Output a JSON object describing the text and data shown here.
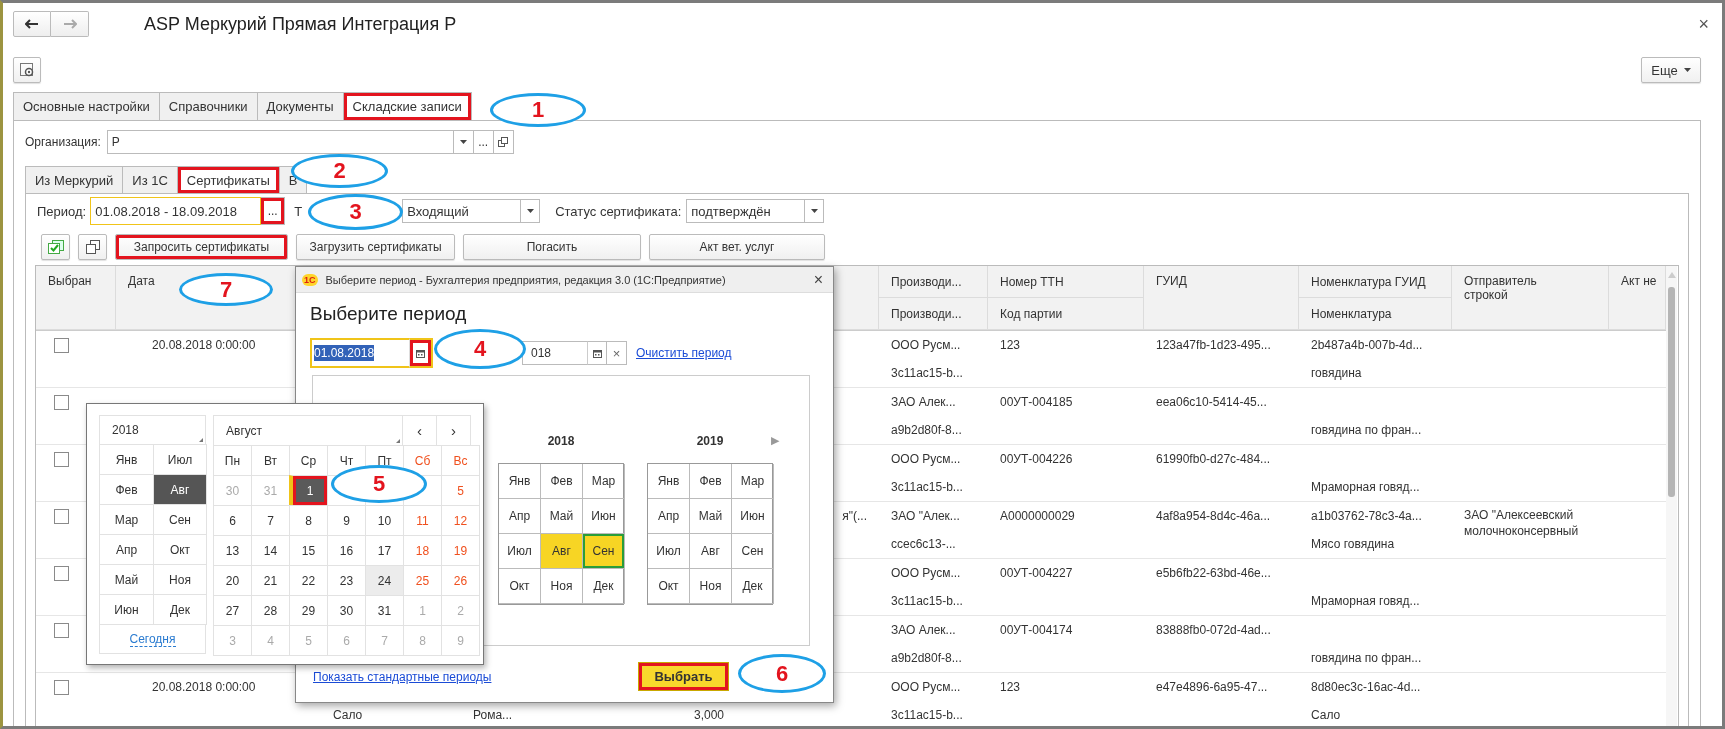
{
  "window": {
    "title": "ASP Меркурий Прямая Интеграция Р",
    "close": "×"
  },
  "more_button": {
    "label": "Еще"
  },
  "tabs": [
    {
      "label": "Основные настройки",
      "selected": false,
      "highlighted": false
    },
    {
      "label": "Справочники",
      "selected": false,
      "highlighted": false
    },
    {
      "label": "Документы",
      "selected": false,
      "highlighted": false
    },
    {
      "label": "Складские записи",
      "selected": true,
      "highlighted": true
    }
  ],
  "organization": {
    "label": "Организация:",
    "value": "Р",
    "select_button": "..."
  },
  "subtabs": [
    {
      "label": "Из Меркурий",
      "selected": false,
      "highlighted": false
    },
    {
      "label": "Из 1С",
      "selected": false,
      "highlighted": false
    },
    {
      "label": "Сертификаты",
      "selected": true,
      "highlighted": true
    },
    {
      "label": "В",
      "selected": false,
      "highlighted": false
    }
  ],
  "period": {
    "label": "Период:",
    "value": "01.08.2018 - 18.09.2018",
    "button": "...",
    "button_highlighted": true
  },
  "type_filter": {
    "label": "Т",
    "value": "Входящий"
  },
  "status_filter": {
    "label": "Статус сертификата:",
    "value": "подтверждён"
  },
  "actions": [
    {
      "label": "Запросить сертификаты",
      "highlighted": true
    },
    {
      "label": "Загрузить сертификаты",
      "highlighted": false
    },
    {
      "label": "Погасить",
      "highlighted": false
    },
    {
      "label": "Акт вет. услуг",
      "highlighted": false
    }
  ],
  "table": {
    "columns": [
      {
        "label": "Выбран"
      },
      {
        "label": "Дата"
      },
      {
        "label": "Производи...",
        "label_2": "Производи..."
      },
      {
        "label": "Номер ТТН",
        "label_2": "Код партии"
      },
      {
        "label": "ГУИД"
      },
      {
        "label": "Номенклатура ГУИД",
        "label_2": "Номенклатура"
      },
      {
        "label": "Отправитель строкой"
      },
      {
        "label": "Акт не"
      }
    ],
    "rows": [
      {
        "selected": false,
        "date": "20.08.2018 0:00:00",
        "producer": "ООО Русм...",
        "producer_id": "3c11ac15-b...",
        "ttn": "123",
        "guid": "123a47fb-1d23-495...",
        "nomenclature_guid": "2b487a4b-007b-4d...",
        "nomenclature": "говядина"
      },
      {
        "selected": false,
        "producer": "ЗАО Алек...",
        "producer_id": "a9b2d80f-8...",
        "ttn": "00УТ-004185",
        "guid": "eea06c10-5414-45...",
        "nomenclature": "говядина по фран..."
      },
      {
        "selected": false,
        "producer": "ООО Русм...",
        "producer_id": "3c11ac15-b...",
        "ttn": "00УТ-004226",
        "guid": "61990fb0-d27c-484...",
        "nomenclature": "Мраморная говяд..."
      },
      {
        "selected": false,
        "column_6": "я\"(...",
        "producer": "ЗАО \"Алек...",
        "producer_id": "ccec6c13-...",
        "ttn": "A0000000029",
        "guid": "4af8a954-8d4c-46a...",
        "nomenclature_guid": "a1b03762-78c3-4a...",
        "nomenclature": "Мясо говядина",
        "sender": "ЗАО \"Алексеевский молочноконсервный"
      },
      {
        "selected": false,
        "producer": "ООО Русм...",
        "producer_id": "3c11ac15-b...",
        "ttn": "00УТ-004227",
        "guid": "e5b6fb22-63bd-46e...",
        "nomenclature": "Мраморная говяд..."
      },
      {
        "selected": false,
        "producer": "ЗАО Алек...",
        "producer_id": "a9b2d80f-8...",
        "ttn": "00УТ-004174",
        "guid": "83888fb0-072d-4ad...",
        "nomenclature": "говядина по фран..."
      },
      {
        "selected": false,
        "date": "20.08.2018 0:00:00",
        "column_3": "Сало",
        "column_4": "Рома...",
        "column_5": "3,000",
        "producer": "ООО Русм...",
        "producer_id": "3c11ac15-b...",
        "ttn": "123",
        "guid": "e47e4896-6a95-47...",
        "nomenclature_guid": "8d80ec3c-16ac-4d...",
        "nomenclature": "Сало"
      }
    ]
  },
  "dialog": {
    "badge": "1С",
    "title": "Выберите период - Бухгалтерия предприятия, редакция 3.0  (1С:Предприятие)",
    "close": "×",
    "heading": "Выберите период",
    "start": {
      "value": "01.08.2018",
      "calendar_highlighted": true
    },
    "end": {
      "value": "018"
    },
    "clear": "×",
    "clear_link": "Очистить период",
    "next_arrow": "▶",
    "years": [
      {
        "year": "2018",
        "months": [
          {
            "label": "Янв",
            "selected": false,
            "outlined": false
          },
          {
            "label": "Фев",
            "selected": false,
            "outlined": false
          },
          {
            "label": "Мар",
            "selected": false,
            "outlined": false
          },
          {
            "label": "Апр",
            "selected": false,
            "outlined": false
          },
          {
            "label": "Май",
            "selected": false,
            "outlined": false
          },
          {
            "label": "Июн",
            "selected": false,
            "outlined": false
          },
          {
            "label": "Июл",
            "selected": false,
            "outlined": false
          },
          {
            "label": "Авг",
            "selected": true,
            "outlined": false
          },
          {
            "label": "Сен",
            "selected": true,
            "outlined": true
          },
          {
            "label": "Окт",
            "selected": false,
            "outlined": false
          },
          {
            "label": "Ноя",
            "selected": false,
            "outlined": false
          },
          {
            "label": "Дек",
            "selected": false,
            "outlined": false
          }
        ]
      },
      {
        "year": "2019",
        "months": [
          {
            "label": "Янв",
            "selected": false,
            "outlined": false
          },
          {
            "label": "Фев",
            "selected": false,
            "outlined": false
          },
          {
            "label": "Мар",
            "selected": false,
            "outlined": false
          },
          {
            "label": "Апр",
            "selected": false,
            "outlined": false
          },
          {
            "label": "Май",
            "selected": false,
            "outlined": false
          },
          {
            "label": "Июн",
            "selected": false,
            "outlined": false
          },
          {
            "label": "Июл",
            "selected": false,
            "outlined": false
          },
          {
            "label": "Авг",
            "selected": false,
            "outlined": false
          },
          {
            "label": "Сен",
            "selected": false,
            "outlined": false
          },
          {
            "label": "Окт",
            "selected": false,
            "outlined": false
          },
          {
            "label": "Ноя",
            "selected": false,
            "outlined": false
          },
          {
            "label": "Дек",
            "selected": false,
            "outlined": false
          }
        ]
      }
    ],
    "standard_link": "Показать стандартные периоды",
    "choose_button": {
      "label": "Выбрать",
      "highlighted": true
    }
  },
  "calendar_popup": {
    "year": "2018",
    "month": "Август",
    "prev": "‹",
    "next": "›",
    "today_link": "Сегодня",
    "months": [
      {
        "label": "Янв",
        "selected": false
      },
      {
        "label": "Июл",
        "selected": false
      },
      {
        "label": "Фев",
        "selected": false
      },
      {
        "label": "Авг",
        "selected": true
      },
      {
        "label": "Мар",
        "selected": false
      },
      {
        "label": "Сен",
        "selected": false
      },
      {
        "label": "Апр",
        "selected": false
      },
      {
        "label": "Окт",
        "selected": false
      },
      {
        "label": "Май",
        "selected": false
      },
      {
        "label": "Ноя",
        "selected": false
      },
      {
        "label": "Июн",
        "selected": false
      },
      {
        "label": "Дек",
        "selected": false
      }
    ],
    "weekdays": [
      {
        "label": "Пн",
        "weekend": false
      },
      {
        "label": "Вт",
        "weekend": false
      },
      {
        "label": "Ср",
        "weekend": false
      },
      {
        "label": "Чт",
        "weekend": false
      },
      {
        "label": "Пт",
        "weekend": false
      },
      {
        "label": "Сб",
        "weekend": true
      },
      {
        "label": "Вс",
        "weekend": true
      }
    ],
    "days": [
      {
        "label": "30",
        "kind": "other_month"
      },
      {
        "label": "31",
        "kind": "other_month"
      },
      {
        "label": "1",
        "kind": "selected_day",
        "highlighted": true
      },
      {
        "kind": "covered"
      },
      {
        "kind": "covered"
      },
      {
        "kind": "covered"
      },
      {
        "label": "5",
        "kind": "weekend"
      },
      {
        "label": "6",
        "kind": "day"
      },
      {
        "label": "7",
        "kind": "day"
      },
      {
        "label": "8",
        "kind": "day"
      },
      {
        "label": "9",
        "kind": "day"
      },
      {
        "label": "10",
        "kind": "day"
      },
      {
        "label": "11",
        "kind": "weekend"
      },
      {
        "label": "12",
        "kind": "weekend"
      },
      {
        "label": "13",
        "kind": "day"
      },
      {
        "label": "14",
        "kind": "day"
      },
      {
        "label": "15",
        "kind": "day"
      },
      {
        "label": "16",
        "kind": "day"
      },
      {
        "label": "17",
        "kind": "day"
      },
      {
        "label": "18",
        "kind": "weekend"
      },
      {
        "label": "19",
        "kind": "weekend"
      },
      {
        "label": "20",
        "kind": "day"
      },
      {
        "label": "21",
        "kind": "day"
      },
      {
        "label": "22",
        "kind": "day"
      },
      {
        "label": "23",
        "kind": "day"
      },
      {
        "label": "24",
        "kind": "today"
      },
      {
        "label": "25",
        "kind": "weekend"
      },
      {
        "label": "26",
        "kind": "weekend"
      },
      {
        "label": "27",
        "kind": "day"
      },
      {
        "label": "28",
        "kind": "day"
      },
      {
        "label": "29",
        "kind": "day"
      },
      {
        "label": "30",
        "kind": "day"
      },
      {
        "label": "31",
        "kind": "day"
      },
      {
        "label": "1",
        "kind": "other_month"
      },
      {
        "label": "2",
        "kind": "other_month"
      },
      {
        "label": "3",
        "kind": "other_month"
      },
      {
        "label": "4",
        "kind": "other_month"
      },
      {
        "label": "5",
        "kind": "other_month"
      },
      {
        "label": "6",
        "kind": "other_month"
      },
      {
        "label": "7",
        "kind": "other_month"
      },
      {
        "label": "8",
        "kind": "other_month"
      },
      {
        "label": "9",
        "kind": "other_month"
      }
    ]
  },
  "callouts": [
    {
      "number": "1"
    },
    {
      "number": "2"
    },
    {
      "number": "3"
    },
    {
      "number": "4"
    },
    {
      "number": "5"
    },
    {
      "number": "6"
    },
    {
      "number": "7"
    }
  ]
}
